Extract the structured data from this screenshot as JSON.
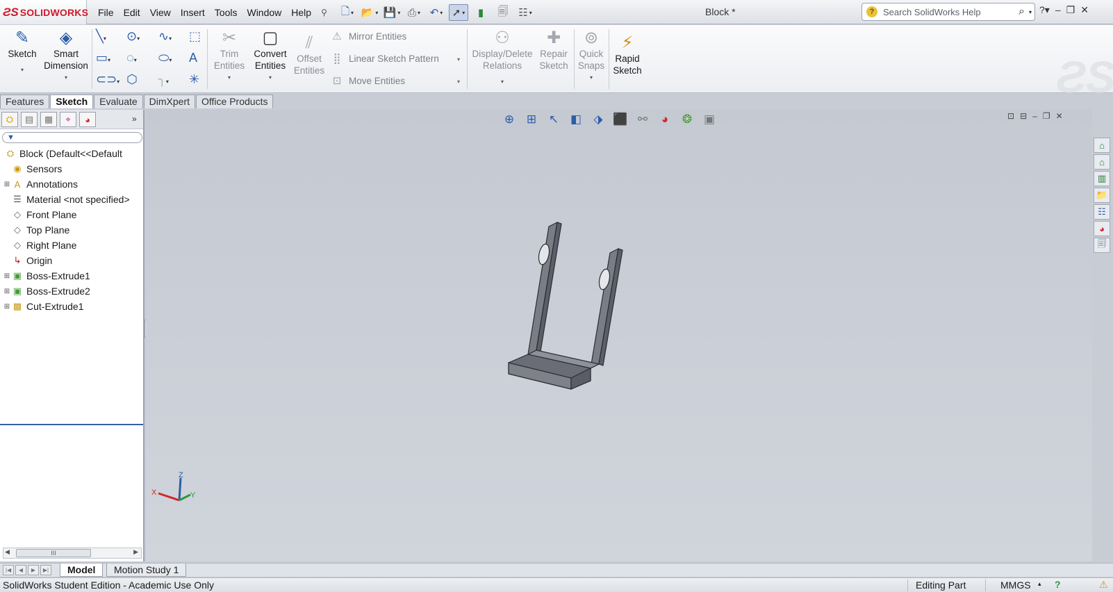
{
  "app": {
    "logo_text": "SOLIDWORKS",
    "document_title": "Block *"
  },
  "menu": [
    "File",
    "Edit",
    "View",
    "Insert",
    "Tools",
    "Window",
    "Help"
  ],
  "help_search": {
    "placeholder": "Search SolidWorks Help"
  },
  "ribbon": {
    "sketch": "Sketch",
    "smart_dimension": [
      "Smart",
      "Dimension"
    ],
    "trim_entities": [
      "Trim",
      "Entities"
    ],
    "convert_entities": [
      "Convert",
      "Entities"
    ],
    "offset_entities": [
      "Offset",
      "Entities"
    ],
    "mirror_entities": "Mirror Entities",
    "linear_sketch_pattern": "Linear Sketch Pattern",
    "move_entities": "Move Entities",
    "display_delete_relations": [
      "Display/Delete",
      "Relations"
    ],
    "repair_sketch": [
      "Repair",
      "Sketch"
    ],
    "quick_snaps": [
      "Quick",
      "Snaps"
    ],
    "rapid_sketch": [
      "Rapid",
      "Sketch"
    ]
  },
  "command_tabs": [
    "Features",
    "Sketch",
    "Evaluate",
    "DimXpert",
    "Office Products"
  ],
  "active_command_tab": "Sketch",
  "feature_tree": [
    {
      "label": "Block  (Default<<Default",
      "icon": "part-icon",
      "expand": ""
    },
    {
      "label": "Sensors",
      "icon": "sensors-icon",
      "expand": ""
    },
    {
      "label": "Annotations",
      "icon": "annotations-icon",
      "expand": "+"
    },
    {
      "label": "Material <not specified>",
      "icon": "material-icon",
      "expand": ""
    },
    {
      "label": "Front Plane",
      "icon": "plane-icon",
      "expand": ""
    },
    {
      "label": "Top Plane",
      "icon": "plane-icon",
      "expand": ""
    },
    {
      "label": "Right Plane",
      "icon": "plane-icon",
      "expand": ""
    },
    {
      "label": "Origin",
      "icon": "origin-icon",
      "expand": ""
    },
    {
      "label": "Boss-Extrude1",
      "icon": "extrude-icon",
      "expand": "+"
    },
    {
      "label": "Boss-Extrude2",
      "icon": "extrude-icon",
      "expand": "+"
    },
    {
      "label": "Cut-Extrude1",
      "icon": "cut-extrude-icon",
      "expand": "+"
    }
  ],
  "triad": {
    "x": "X",
    "y": "Y",
    "z": "Z"
  },
  "bottom_tabs": [
    "Model",
    "Motion Study 1"
  ],
  "status": {
    "text": "SolidWorks Student Edition - Academic Use Only",
    "mode": "Editing Part",
    "units": "MMGS"
  },
  "colors": {
    "brand_red": "#d0182b",
    "accent_blue": "#2a5ea8",
    "viewport_bg": "#c8ccd4",
    "model_face": "#8a8d96"
  }
}
